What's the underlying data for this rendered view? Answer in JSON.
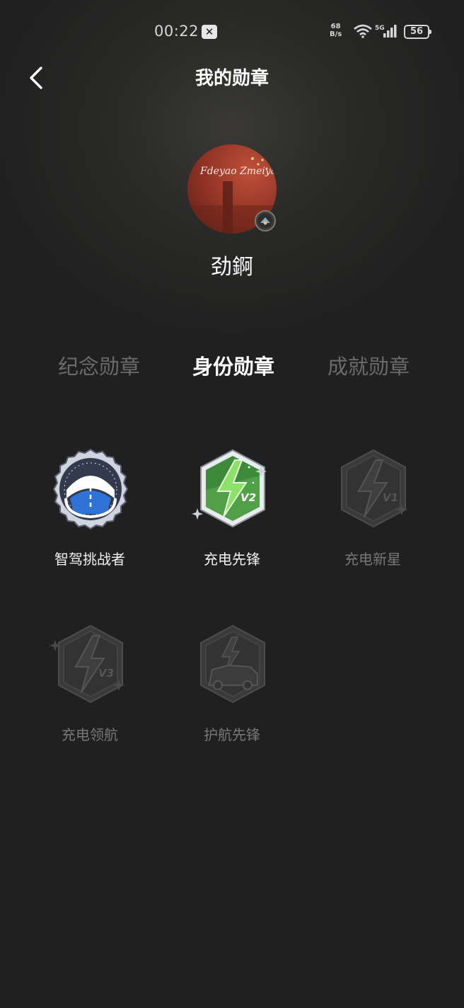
{
  "status_bar": {
    "time": "00:22",
    "app_icon": "x-logo-icon",
    "net_speed_value": "68",
    "net_speed_unit": "B/s",
    "network_type": "5G",
    "battery": "56"
  },
  "header": {
    "back_icon": "chevron-left-icon",
    "title": "我的勋章"
  },
  "profile": {
    "avatar_text": "Fdeyao Zmeiyan",
    "name": "劲錒"
  },
  "tabs": [
    {
      "label": "纪念勋章",
      "active": false
    },
    {
      "label": "身份勋章",
      "active": true
    },
    {
      "label": "成就勋章",
      "active": false
    }
  ],
  "badges": [
    {
      "label": "智驾挑战者",
      "earned": true,
      "icon": "steering-wheel-road-icon"
    },
    {
      "label": "充电先锋",
      "earned": true,
      "icon": "lightning-v2-icon",
      "tag": "V2"
    },
    {
      "label": "充电新星",
      "earned": false,
      "icon": "lightning-v1-icon",
      "tag": "V1"
    },
    {
      "label": "充电领航",
      "earned": false,
      "icon": "lightning-v3-icon",
      "tag": "V3"
    },
    {
      "label": "护航先锋",
      "earned": false,
      "icon": "car-lightning-icon"
    }
  ],
  "colors": {
    "background": "#202020",
    "active_tab": "#ffffff",
    "inactive_tab": "#6b6b6b",
    "badge_blue": "#2f73d6",
    "badge_green": "#3c8a3a"
  }
}
